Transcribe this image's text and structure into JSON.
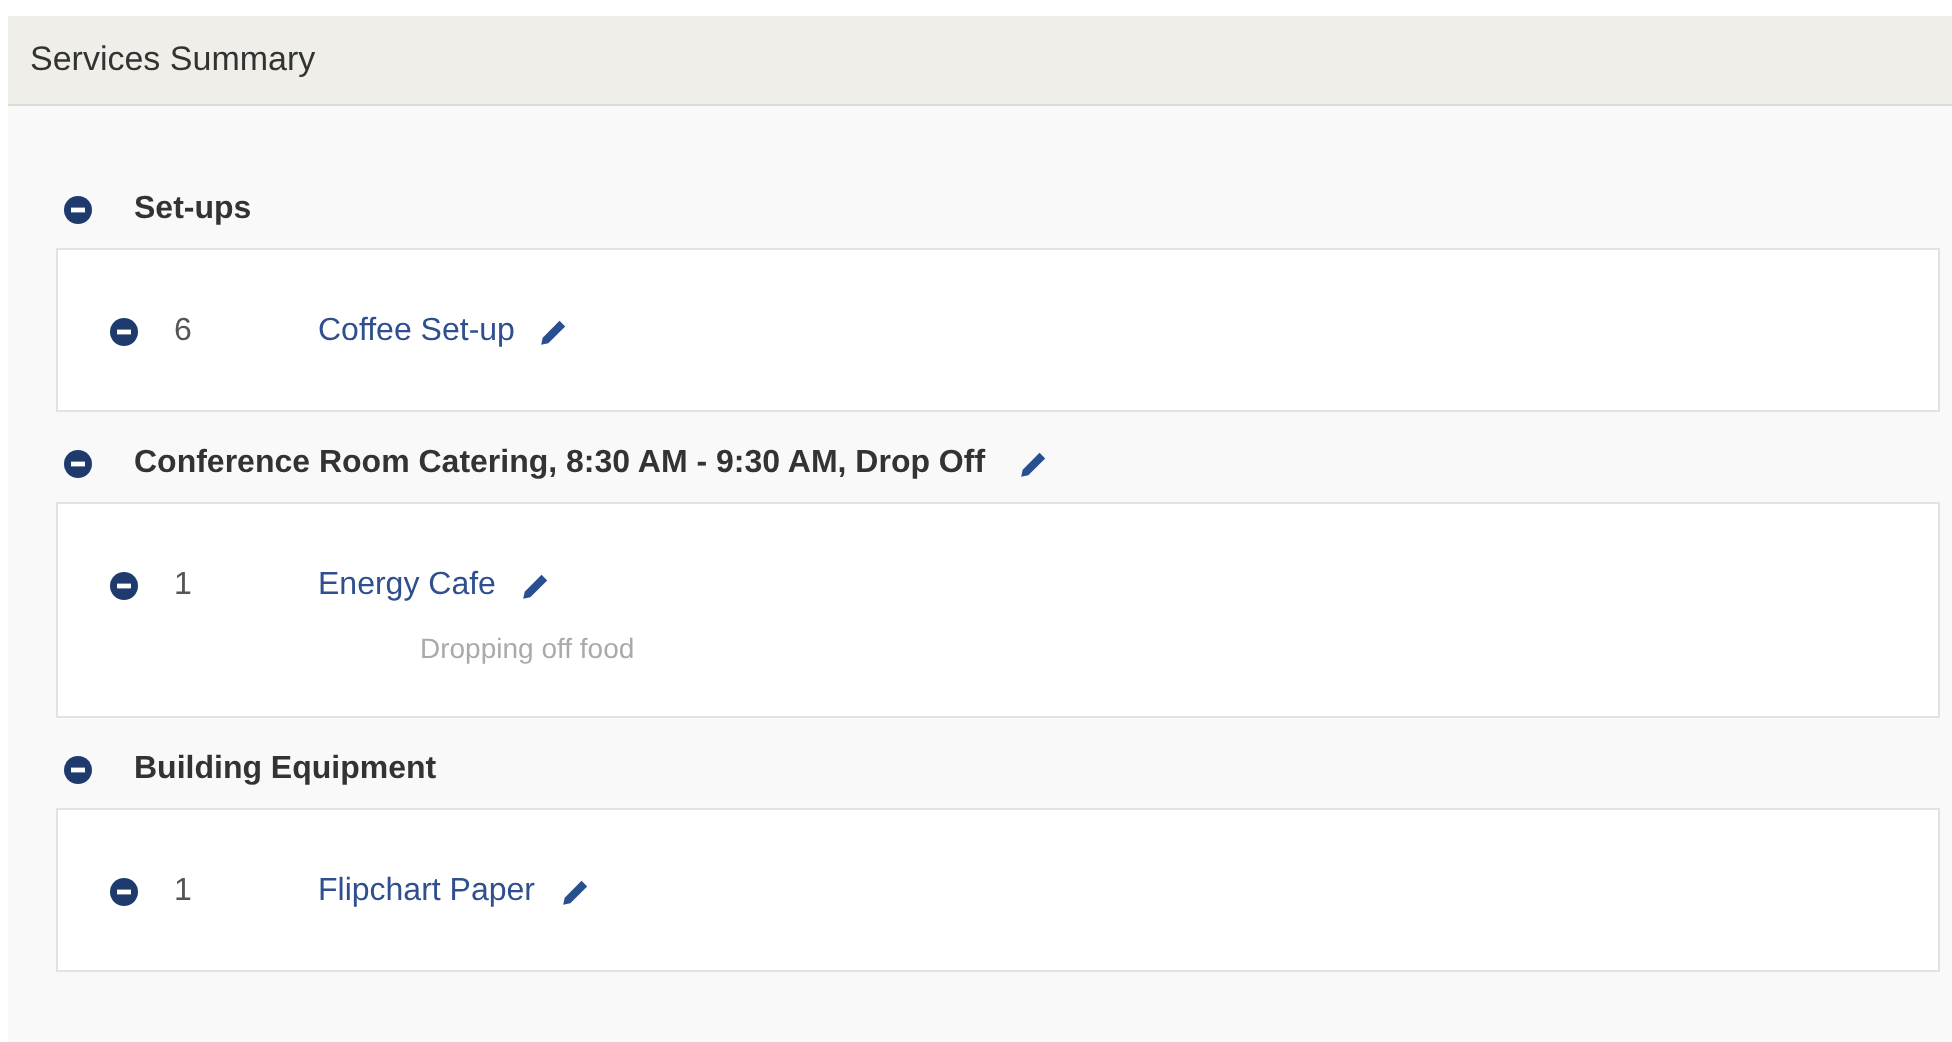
{
  "panel": {
    "title": "Services Summary"
  },
  "groups": [
    {
      "title": "Set-ups",
      "expanded": true,
      "editable": false,
      "items": [
        {
          "quantity": "6",
          "name": "Coffee Set-up",
          "expanded": true,
          "editable": true
        }
      ]
    },
    {
      "title": "Conference Room Catering, 8:30 AM - 9:30 AM, Drop Off",
      "expanded": true,
      "editable": true,
      "items": [
        {
          "quantity": "1",
          "name": "Energy Cafe",
          "expanded": true,
          "editable": true,
          "note": "Dropping off food"
        }
      ]
    },
    {
      "title": "Building Equipment",
      "expanded": true,
      "editable": false,
      "items": [
        {
          "quantity": "1",
          "name": "Flipchart Paper",
          "expanded": true,
          "editable": true
        }
      ]
    }
  ]
}
